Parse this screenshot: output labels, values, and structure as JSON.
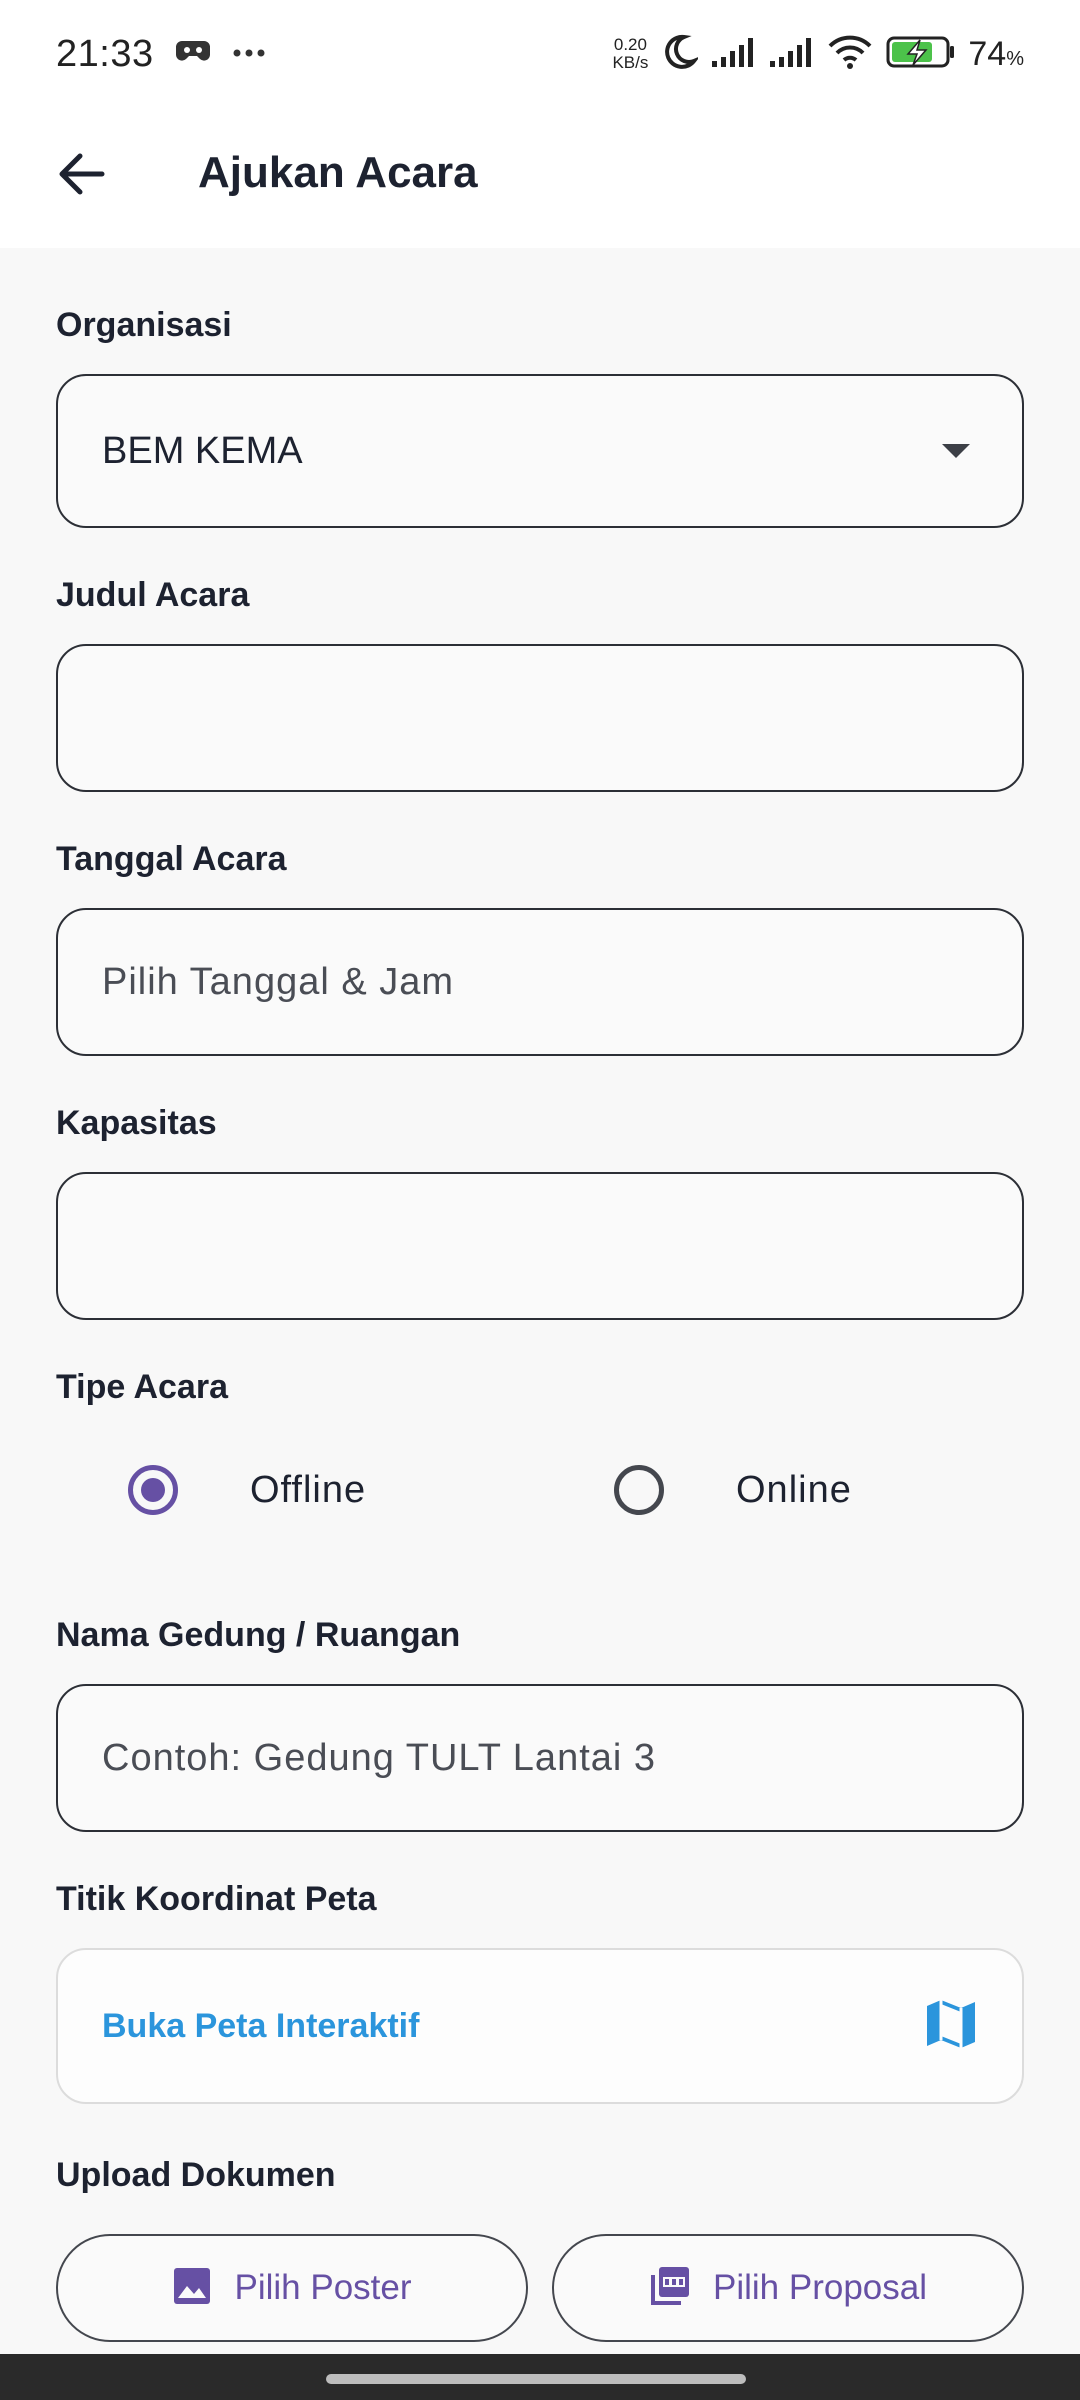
{
  "status_bar": {
    "time": "21:33",
    "net_speed_value": "0.20",
    "net_speed_unit": "KB/s",
    "battery_level": "74",
    "battery_unit": "%"
  },
  "app_bar": {
    "title": "Ajukan Acara"
  },
  "form": {
    "organisasi": {
      "label": "Organisasi",
      "value": "BEM KEMA"
    },
    "judul": {
      "label": "Judul Acara",
      "value": ""
    },
    "tanggal": {
      "label": "Tanggal Acara",
      "placeholder": "Pilih Tanggal & Jam"
    },
    "kapasitas": {
      "label": "Kapasitas",
      "value": ""
    },
    "tipe": {
      "label": "Tipe Acara",
      "options": [
        {
          "label": "Offline",
          "selected": true
        },
        {
          "label": "Online",
          "selected": false
        }
      ]
    },
    "gedung": {
      "label": "Nama Gedung / Ruangan",
      "placeholder": "Contoh: Gedung TULT Lantai 3"
    },
    "koordinat": {
      "label": "Titik Koordinat Peta",
      "button_label": "Buka Peta Interaktif"
    },
    "upload": {
      "label": "Upload Dokumen",
      "poster_label": "Pilih Poster",
      "proposal_label": "Pilih Proposal"
    }
  },
  "colors": {
    "accent": "#6650a4",
    "map_link": "#2b95dc",
    "border": "#2c2f36"
  },
  "icons": {
    "back": "arrow-left-icon",
    "dropdown": "caret-down-icon",
    "map": "map-icon",
    "poster": "image-icon",
    "proposal": "pdf-icon"
  }
}
